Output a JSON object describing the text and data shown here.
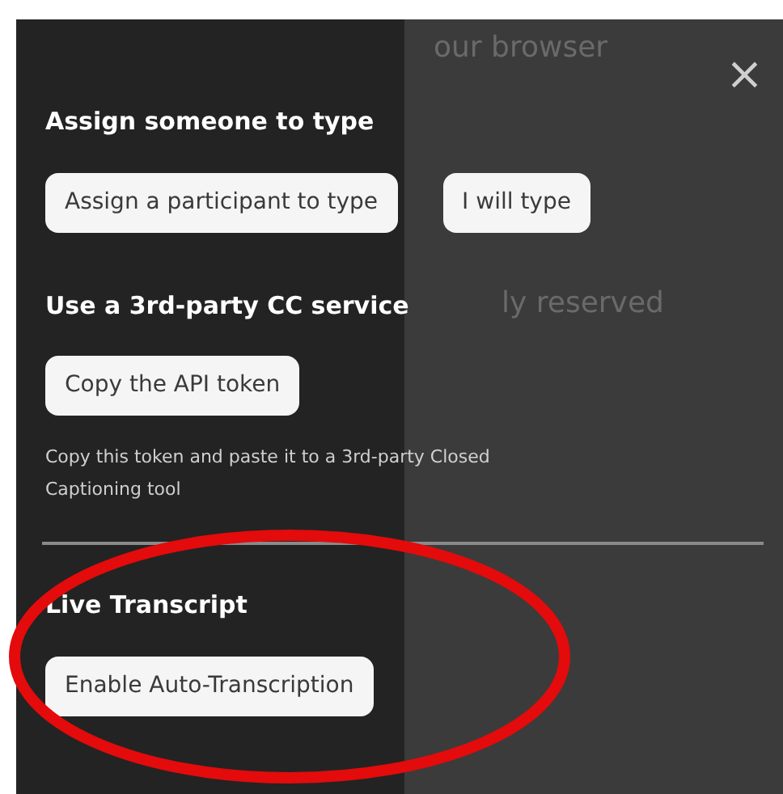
{
  "background_text": [
    "our browser",
    "ly reserved"
  ],
  "sections": [
    {
      "heading": "Assign someone to type",
      "buttons": [
        "Assign a participant to type",
        "I will type"
      ]
    },
    {
      "heading": "Use a 3rd-party CC service",
      "buttons": [
        "Copy the API token"
      ],
      "description": "Copy this token and paste it to a 3rd-party Closed Captioning tool"
    },
    {
      "heading": "Live Transcript",
      "buttons": [
        "Enable Auto-Transcription"
      ],
      "divider_before": true,
      "highlighted": true
    }
  ],
  "close": "×"
}
